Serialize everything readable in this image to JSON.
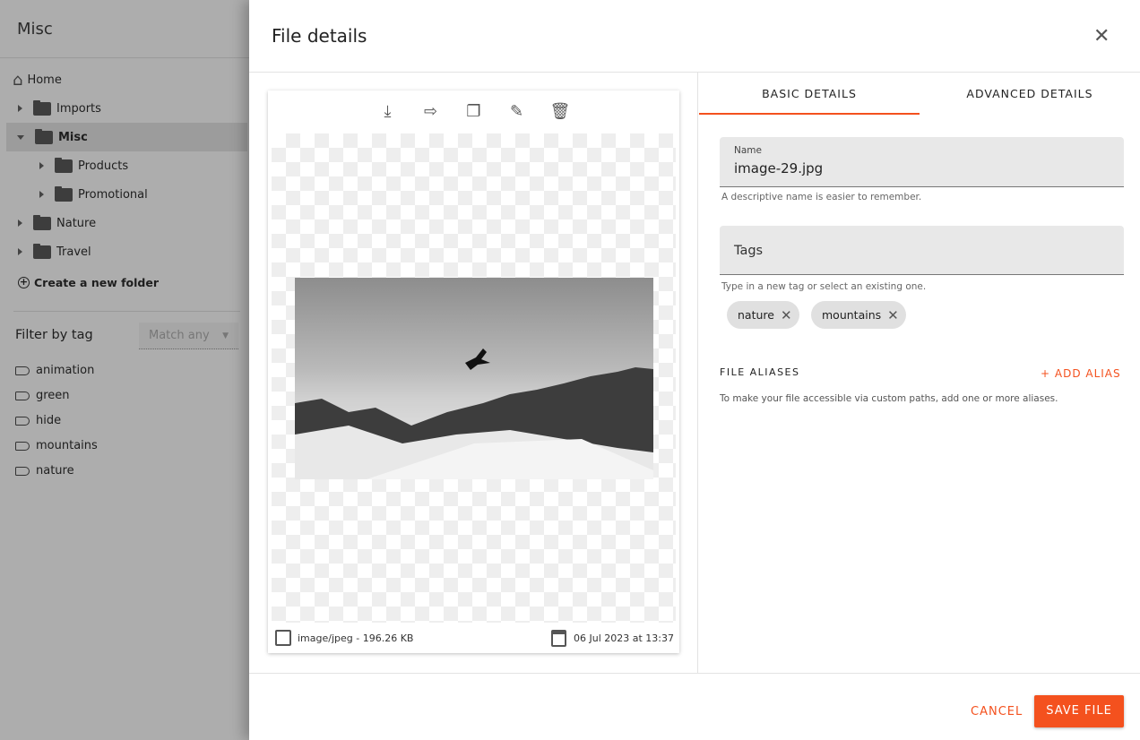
{
  "sidebar": {
    "title": "Misc",
    "tree": [
      {
        "label": "Home",
        "icon": "home-icon"
      },
      {
        "label": "Imports",
        "icon": "folder-icon"
      },
      {
        "label": "Misc",
        "icon": "folder-open-icon",
        "active": true
      },
      {
        "label": "Products",
        "icon": "folder-icon"
      },
      {
        "label": "Promotional",
        "icon": "folder-icon"
      },
      {
        "label": "Nature",
        "icon": "folder-icon"
      },
      {
        "label": "Travel",
        "icon": "folder-icon"
      }
    ],
    "create_folder": "Create a new folder",
    "filter_label": "Filter by tag",
    "match_select": "Match any",
    "tags": [
      "animation",
      "green",
      "hide",
      "mountains",
      "nature"
    ]
  },
  "dialog": {
    "title": "File details",
    "toolbar": [
      "download-icon",
      "move-to-folder-icon",
      "copy-icon",
      "edit-icon",
      "delete-icon"
    ],
    "file_info": "image/jpeg - 196.26 KB",
    "date": "06 Jul 2023 at 13:37",
    "tabs": [
      "BASIC DETAILS",
      "ADVANCED DETAILS"
    ],
    "name_label": "Name",
    "name_value": "image-29.jpg",
    "name_help": "A descriptive name is easier to remember.",
    "tags_label": "Tags",
    "tags_help": "Type in a new tag or select an existing one.",
    "chips": [
      "nature",
      "mountains"
    ],
    "aliases_title": "FILE ALIASES",
    "add_alias": "+ ADD ALIAS",
    "aliases_help": "To make your file accessible via custom paths, add one or more aliases.",
    "cancel": "CANCEL",
    "save": "SAVE FILE"
  },
  "colors": {
    "accent": "#f4511e"
  }
}
